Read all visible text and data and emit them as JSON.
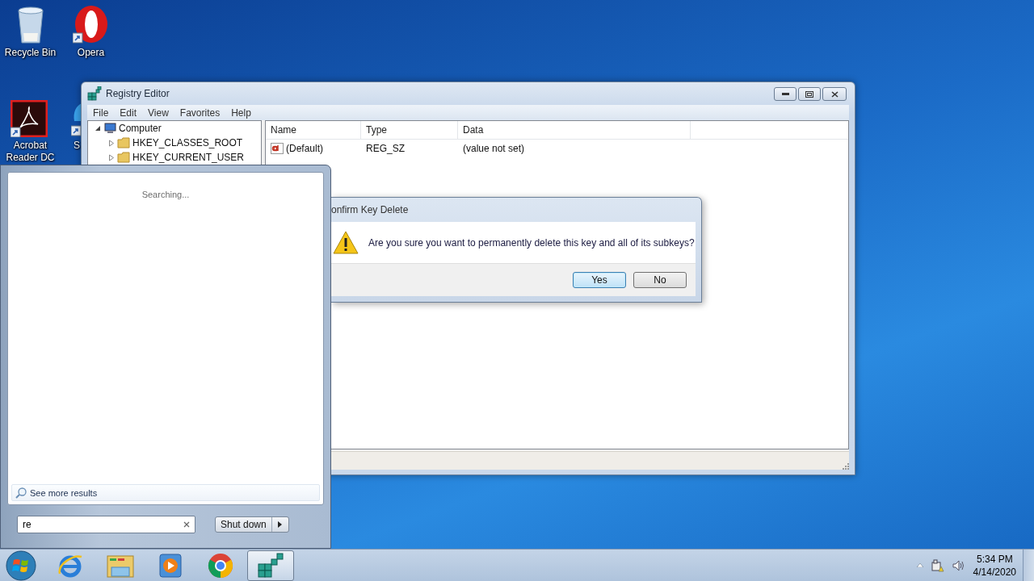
{
  "desktop_icons": [
    {
      "label": "Recycle Bin",
      "kind": "recycle"
    },
    {
      "label": "Opera",
      "kind": "opera"
    },
    {
      "label": "Acrobat Reader DC",
      "kind": "acrobat"
    },
    {
      "label": "S",
      "kind": "partial"
    }
  ],
  "registry_editor": {
    "title": "Registry Editor",
    "menu": [
      "File",
      "Edit",
      "View",
      "Favorites",
      "Help"
    ],
    "tree": [
      {
        "label": "Computer",
        "kind": "computer",
        "expanded": true,
        "children": [
          {
            "label": "HKEY_CLASSES_ROOT",
            "kind": "folder",
            "expanded": false
          },
          {
            "label": "HKEY_CURRENT_USER",
            "kind": "folder",
            "expanded": false
          }
        ]
      }
    ],
    "columns": [
      "Name",
      "Type",
      "Data"
    ],
    "rows": [
      {
        "name": "(Default)",
        "type": "REG_SZ",
        "data": "(value not set)"
      }
    ]
  },
  "dialog": {
    "title": "onfirm Key Delete",
    "message": "Are you sure you want to permanently delete this key and all of its subkeys?",
    "buttons": [
      {
        "label": "Yes",
        "selected": true
      },
      {
        "label": "No",
        "selected": false
      }
    ]
  },
  "start_menu": {
    "status": "Searching...",
    "more_results": "See more results",
    "search": {
      "value": "re"
    },
    "shutdown": "Shut down"
  },
  "taskbar": {
    "apps": [
      {
        "kind": "ie",
        "active": false
      },
      {
        "kind": "explorer",
        "active": false
      },
      {
        "kind": "media",
        "active": false
      },
      {
        "kind": "chrome",
        "active": false
      },
      {
        "kind": "regedit",
        "active": true
      }
    ],
    "clock": {
      "time": "5:34 PM",
      "date": "4/14/2020"
    }
  }
}
